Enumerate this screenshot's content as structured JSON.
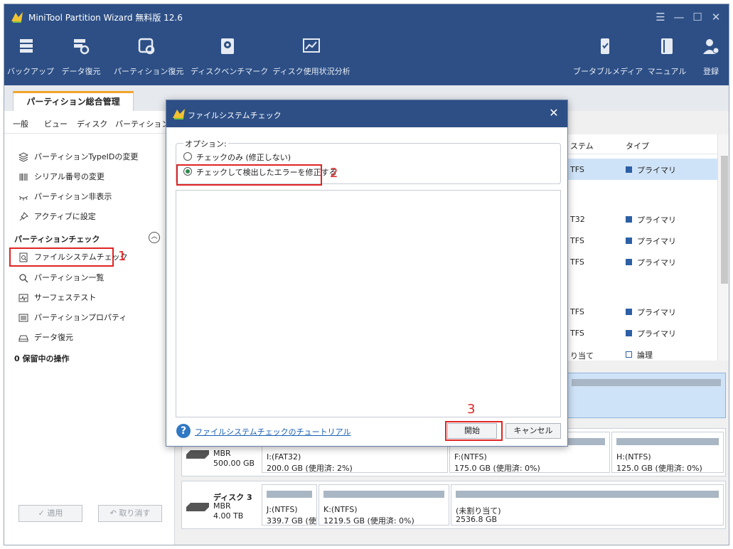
{
  "app": {
    "title": "MiniTool Partition Wizard 無料版 12.6"
  },
  "toolbar": {
    "items": [
      {
        "label": "バックアップ",
        "icon": "backup-icon"
      },
      {
        "label": "データ復元",
        "icon": "data-recovery-icon"
      },
      {
        "label": "パーティション復元",
        "icon": "partition-recovery-icon"
      },
      {
        "label": "ディスクベンチマーク",
        "icon": "disk-benchmark-icon"
      },
      {
        "label": "ディスク使用状況分析",
        "icon": "space-analyzer-icon"
      },
      {
        "label": "ブータブルメディア",
        "icon": "bootable-media-icon"
      },
      {
        "label": "マニュアル",
        "icon": "manual-icon"
      },
      {
        "label": "登録",
        "icon": "register-icon"
      }
    ]
  },
  "tabs": {
    "main": "パーティション総合管理"
  },
  "menu": [
    "一般",
    "ビュー",
    "ディスク",
    "パーティション"
  ],
  "left_actions": [
    {
      "label": "パーティションTypeIDの変更",
      "icon": "layers-icon"
    },
    {
      "label": "シリアル番号の変更",
      "icon": "barcode-icon"
    },
    {
      "label": "パーティション非表示",
      "icon": "hide-icon"
    },
    {
      "label": "アクティブに設定",
      "icon": "pin-icon"
    }
  ],
  "check_section": {
    "title": "パーティションチェック",
    "items": [
      {
        "label": "ファイルシステムチェック",
        "icon": "file-check-icon"
      },
      {
        "label": "パーティション一覧",
        "icon": "search-icon"
      },
      {
        "label": "サーフェステスト",
        "icon": "surface-test-icon"
      },
      {
        "label": "パーティションプロパティ",
        "icon": "properties-icon"
      },
      {
        "label": "データ復元",
        "icon": "drive-recovery-icon"
      }
    ]
  },
  "pending": "0 保留中の操作",
  "bottom_buttons": {
    "apply": "✓ 適用",
    "undo": "↶ 取り消す"
  },
  "annotations": {
    "one": "1",
    "two": "2",
    "three": "3"
  },
  "table": {
    "headers": {
      "fs": "ステム",
      "type": "タイプ"
    },
    "rows": [
      {
        "fs": "TFS",
        "type": "プライマリ",
        "selected": true
      },
      {
        "fs": "",
        "type": ""
      },
      {
        "fs": "T32",
        "type": "プライマリ"
      },
      {
        "fs": "TFS",
        "type": "プライマリ"
      },
      {
        "fs": "TFS",
        "type": "プライマリ"
      },
      {
        "fs": "",
        "type": ""
      },
      {
        "fs": "TFS",
        "type": "プライマリ"
      },
      {
        "fs": "TFS",
        "type": "プライマリ"
      },
      {
        "fs": "り当て",
        "type": "論理"
      }
    ]
  },
  "disks": [
    {
      "name": "",
      "type": "MBR",
      "size": "500.00 GB",
      "partitions": [
        {
          "name": "I:(FAT32)",
          "size": "200.0 GB (使用済: 2%)"
        },
        {
          "name": "F:(NTFS)",
          "size": "175.0 GB (使用済: 0%)"
        },
        {
          "name": "H:(NTFS)",
          "size": "125.0 GB (使用済: 0%)"
        }
      ]
    },
    {
      "name": "ディスク 3",
      "type": "MBR",
      "size": "4.00 TB",
      "partitions": [
        {
          "name": "J:(NTFS)",
          "size": "339.7 GB (使月"
        },
        {
          "name": "K:(NTFS)",
          "size": "1219.5 GB (使用済: 0%)"
        },
        {
          "name": "(未割り当て)",
          "size": "2536.8 GB"
        }
      ]
    }
  ],
  "dialog": {
    "title": "ファイルシステムチェック",
    "options_legend": "オプション:",
    "option_check_only": "チェックのみ (修正しない)",
    "option_check_fix": "チェックして検出したエラーを修正する",
    "selected_option": "check_fix",
    "tutorial_link": "ファイルシステムチェックのチュートリアル",
    "start": "開始",
    "cancel": "キャンセル"
  },
  "colors": {
    "title_bar": "#2d4f86",
    "highlight_annotation": "#e02424",
    "selection": "#cfe3f8",
    "primary_square": "#2d5fa5"
  }
}
